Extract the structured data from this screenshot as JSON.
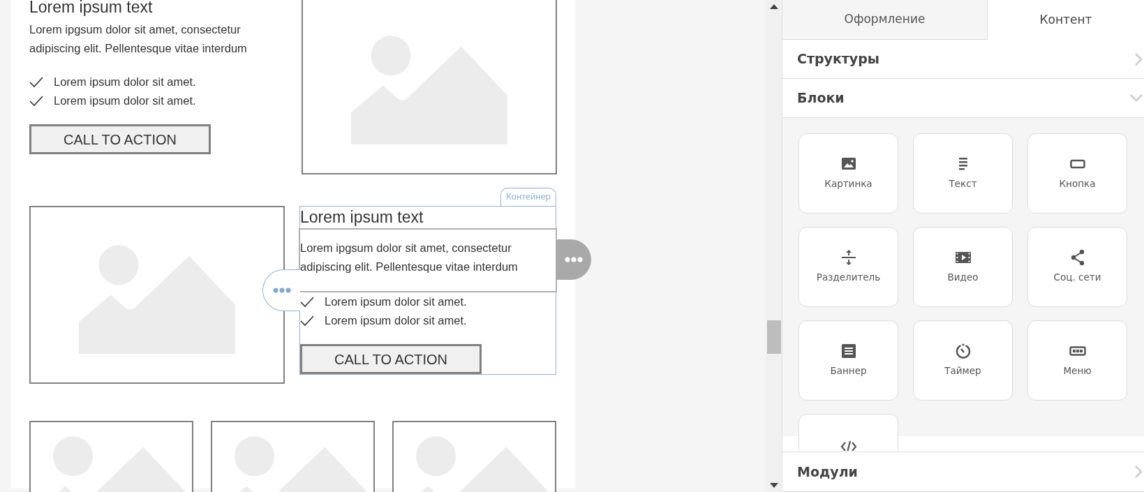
{
  "canvas": {
    "sections": [
      {
        "kind": "image_right",
        "selected": false,
        "heading": "Lorem ipsum text",
        "paragraph": "Lorem ipgsum dolor sit amet, consectetur adipiscing elit. Pellentesque vitae interdum",
        "checklist": [
          "Lorem ipsum dolor sit amet.",
          "Lorem ipsum dolor sit amet."
        ],
        "button": "CALL TO ACTION"
      },
      {
        "kind": "image_left",
        "selected": true,
        "container_label": "Контейнер",
        "heading": "Lorem ipsum text",
        "paragraph": "Lorem ipgsum dolor sit amet, consectetur adipiscing elit. Pellentesque vitae interdum",
        "checklist": [
          "Lorem ipsum dolor sit amet.",
          "Lorem ipsum dolor sit amet."
        ],
        "button": "CALL TO ACTION"
      }
    ],
    "image_row": [
      {
        "kind": "image"
      },
      {
        "kind": "image"
      },
      {
        "kind": "image"
      }
    ]
  },
  "panel": {
    "tabs": [
      {
        "label": "Оформление",
        "selected": false
      },
      {
        "label": "Контент",
        "selected": true
      }
    ],
    "sections": [
      {
        "title": "Структуры",
        "expanded": false
      },
      {
        "title": "Блоки",
        "expanded": true,
        "items": [
          {
            "kind": "image",
            "label": "Картинка"
          },
          {
            "kind": "text",
            "label": "Текст"
          },
          {
            "kind": "button",
            "label": "Кнопка"
          },
          {
            "kind": "divider",
            "label": "Разделитель"
          },
          {
            "kind": "video",
            "label": "Видео"
          },
          {
            "kind": "social",
            "label": "Соц. сети"
          },
          {
            "kind": "banner",
            "label": "Баннер"
          },
          {
            "kind": "timer",
            "label": "Таймер"
          },
          {
            "kind": "menu",
            "label": "Меню"
          },
          {
            "kind": "code"
          }
        ]
      },
      {
        "title": "Модули",
        "expanded": false
      }
    ]
  }
}
